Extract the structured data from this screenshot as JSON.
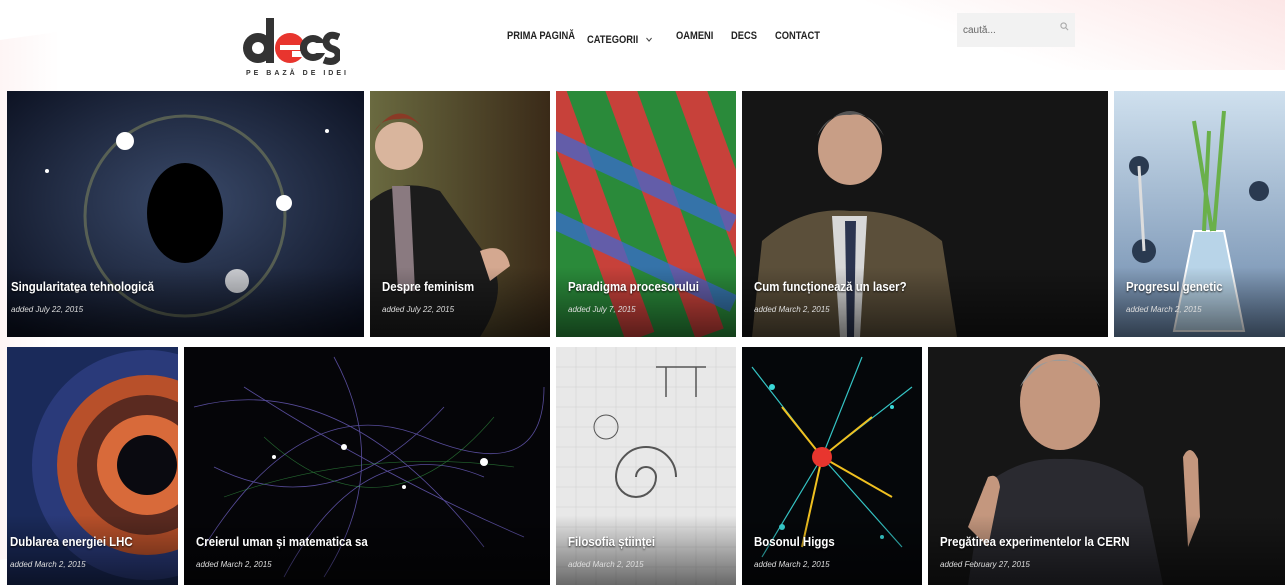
{
  "header": {
    "logo_text": "decs",
    "tagline": "PE BAZĂ DE IDEI",
    "nav": [
      "PRIMA PAGINĂ",
      "CATEGORII",
      "OAMENI",
      "DECS",
      "CONTACT"
    ],
    "search_placeholder": "caută..."
  },
  "colors": {
    "accent": "#e8352e",
    "logo_dark": "#333333"
  },
  "tiles": [
    {
      "title": "Singularitatea tehnologică",
      "date": "added July 22, 2015"
    },
    {
      "title": "Despre feminism",
      "date": "added July 22, 2015"
    },
    {
      "title": "Paradigma procesorului",
      "date": "added July 7, 2015"
    },
    {
      "title": "Cum funcționează un laser?",
      "date": "added March 2, 2015"
    },
    {
      "title": "Progresul genetic",
      "date": "added March 2, 2015"
    },
    {
      "title": "Dublarea energiei LHC",
      "date": "added March 2, 2015"
    },
    {
      "title": "Creierul uman și matematica sa",
      "date": "added March 2, 2015"
    },
    {
      "title": "Filosofia științei",
      "date": "added March 2, 2015"
    },
    {
      "title": "Bosonul Higgs",
      "date": "added March 2, 2015"
    },
    {
      "title": "Pregătirea experimentelor la CERN",
      "date": "added February 27, 2015"
    }
  ]
}
